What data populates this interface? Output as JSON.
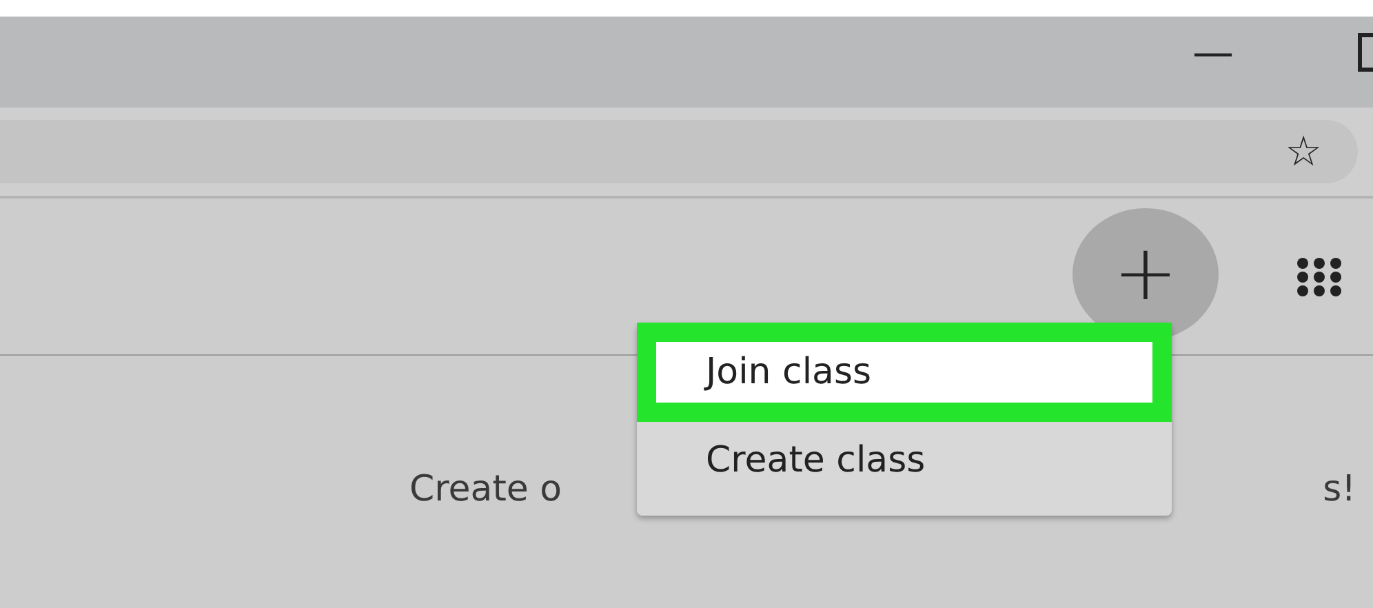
{
  "window": {
    "minimize": "—"
  },
  "address_bar": {
    "bookmark": "☆"
  },
  "toolbar": {
    "add": "+"
  },
  "menu": {
    "items": [
      {
        "label": "Join class",
        "selected": true
      },
      {
        "label": "Create class",
        "selected": false
      }
    ]
  },
  "empty_state": {
    "text_start": "Create o",
    "text_end": "s!"
  }
}
